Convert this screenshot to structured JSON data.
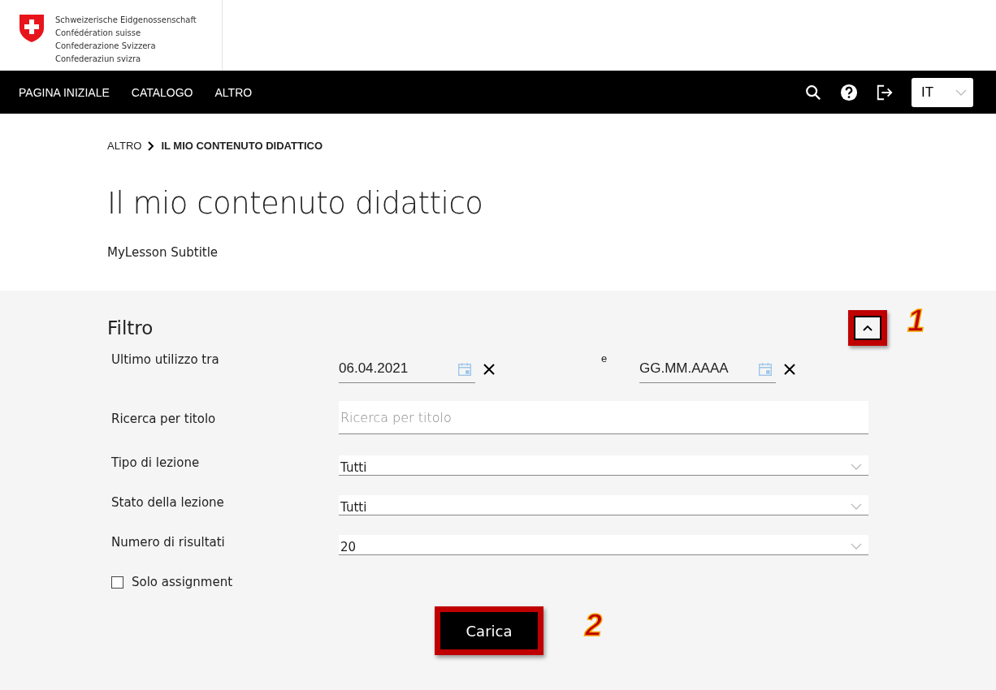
{
  "header": {
    "logo_lines": [
      "Schweizerische Eidgenossenschaft",
      "Confédération suisse",
      "Confederazione Svizzera",
      "Confederaziun svizra"
    ]
  },
  "nav": {
    "items": [
      {
        "label": "PAGINA INIZIALE"
      },
      {
        "label": "CATALOGO"
      },
      {
        "label": "ALTRO"
      }
    ],
    "language": "IT"
  },
  "breadcrumb": [
    "ALTRO",
    "IL MIO CONTENUTO DIDATTICO"
  ],
  "title": "Il mio contenuto didattico",
  "subtitle": "MyLesson Subtitle",
  "filter": {
    "title": "Filtro",
    "expanded": true,
    "collapse_marker": "1",
    "date_range": {
      "label": "Ultimo utilizzo tra",
      "from": "06.04.2021",
      "connector": "e",
      "to_placeholder": "GG.MM.AAAA"
    },
    "search": {
      "label": "Ricerca per titolo",
      "placeholder": "Ricerca per titolo"
    },
    "selects": [
      {
        "label": "Tipo di lezione",
        "value": "Tutti"
      },
      {
        "label": "Stato della lezione",
        "value": "Tutti"
      },
      {
        "label": "Numero di risultati",
        "value": "20"
      }
    ],
    "checkbox": {
      "label": "Solo assignment",
      "checked": false
    },
    "button": {
      "label": "Carica",
      "marker": "2"
    }
  }
}
